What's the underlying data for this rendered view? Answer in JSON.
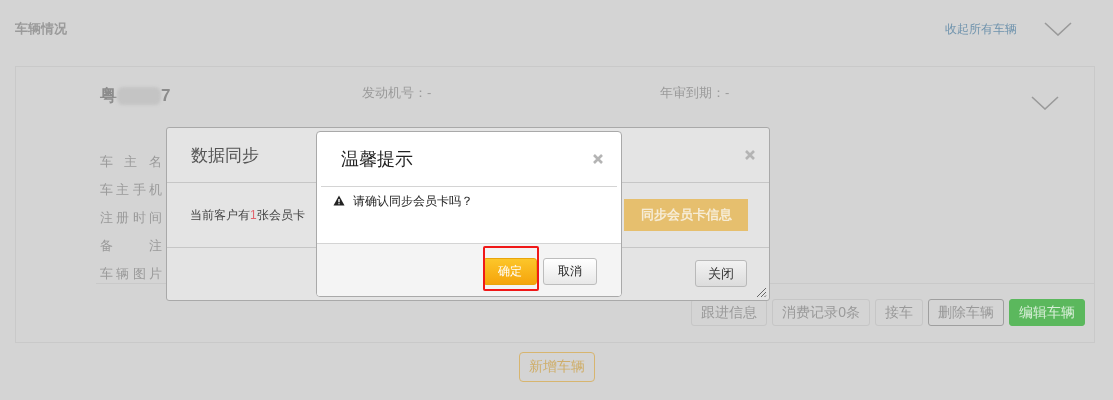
{
  "section": {
    "title": "车辆情况",
    "collapse_link": "收起所有车辆"
  },
  "vehicle": {
    "plate_start": "粤",
    "plate_end": "7",
    "specs": [
      {
        "label": "发动机号：",
        "value": "-"
      },
      {
        "label": "年审到期：",
        "value": "-"
      }
    ],
    "owner_fields": [
      {
        "label": "车 主 名"
      },
      {
        "label": "车主手机"
      },
      {
        "label": "注册时间"
      },
      {
        "label": "备 注"
      },
      {
        "label": "车辆图片"
      }
    ],
    "buttons": [
      {
        "label": "跟进信息",
        "kind": "default"
      },
      {
        "label": "消费记录0条",
        "kind": "default"
      },
      {
        "label": "接车",
        "kind": "default"
      },
      {
        "label": "删除车辆",
        "kind": "outline"
      },
      {
        "label": "编辑车辆",
        "kind": "primary"
      }
    ]
  },
  "add_button": "新增车辆",
  "sync_dialog": {
    "title": "数据同步",
    "message_before": "当前客户有",
    "count": "1",
    "message_after": "张会员卡",
    "action": "同步会员卡信息",
    "close_button": "关闭"
  },
  "confirm_dialog": {
    "title": "温馨提示",
    "message": "请确认同步会员卡吗？",
    "buttons": [
      {
        "label": "确定",
        "kind": "primary",
        "highlighted": true
      },
      {
        "label": "取消",
        "kind": "default",
        "highlighted": false
      }
    ]
  }
}
